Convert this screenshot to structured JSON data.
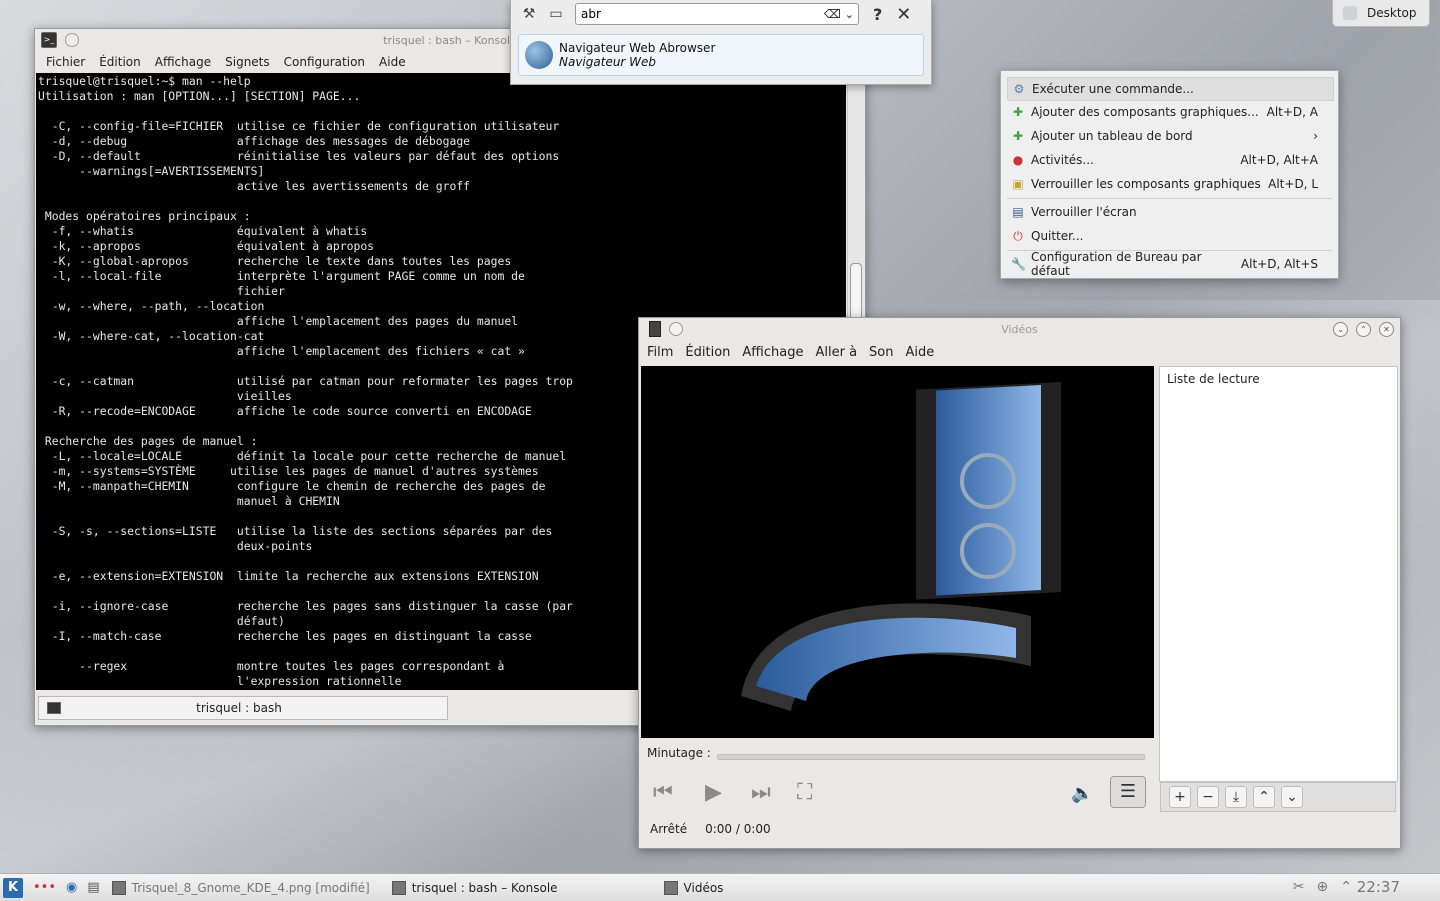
{
  "desktop": {
    "button_label": "Desktop"
  },
  "konsole": {
    "title": "trisquel : bash – Konsole",
    "menu": [
      "Fichier",
      "Édition",
      "Affichage",
      "Signets",
      "Configuration",
      "Aide"
    ],
    "tab_label": "trisquel : bash",
    "terminal_lines": [
      "trisquel@trisquel:~$ man --help",
      "Utilisation : man [OPTION...] [SECTION] PAGE...",
      "",
      "  -C, --config-file=FICHIER  utilise ce fichier de configuration utilisateur",
      "  -d, --debug                affichage des messages de débogage",
      "  -D, --default              réinitialise les valeurs par défaut des options",
      "      --warnings[=AVERTISSEMENTS]",
      "                             active les avertissements de groff",
      "",
      " Modes opératoires principaux :",
      "  -f, --whatis               équivalent à whatis",
      "  -k, --apropos              équivalent à apropos",
      "  -K, --global-apropos       recherche le texte dans toutes les pages",
      "  -l, --local-file           interprète l'argument PAGE comme un nom de",
      "                             fichier",
      "  -w, --where, --path, --location",
      "                             affiche l'emplacement des pages du manuel",
      "  -W, --where-cat, --location-cat",
      "                             affiche l'emplacement des fichiers « cat »",
      "",
      "  -c, --catman               utilisé par catman pour reformater les pages trop",
      "                             vieilles",
      "  -R, --recode=ENCODAGE      affiche le code source converti en ENCODAGE",
      "",
      " Recherche des pages de manuel :",
      "  -L, --locale=LOCALE        définit la locale pour cette recherche de manuel",
      "  -m, --systems=SYSTÈME     utilise les pages de manuel d'autres systèmes",
      "  -M, --manpath=CHEMIN       configure le chemin de recherche des pages de",
      "                             manuel à CHEMIN",
      "",
      "  -S, -s, --sections=LISTE   utilise la liste des sections séparées par des",
      "                             deux-points",
      "",
      "  -e, --extension=EXTENSION  limite la recherche aux extensions EXTENSION",
      "",
      "  -i, --ignore-case          recherche les pages sans distinguer la casse (par",
      "                             défaut)",
      "  -I, --match-case           recherche les pages en distinguant la casse",
      "",
      "      --regex                montre toutes les pages correspondant à",
      "                             l'expression rationnelle"
    ]
  },
  "krunner": {
    "query": "abr",
    "result_title": "Navigateur Web Abrowser",
    "result_subtitle": "Navigateur Web",
    "icons": [
      "settings-icon",
      "activity-icon",
      "help-icon",
      "close-icon"
    ]
  },
  "context_menu": {
    "items": [
      {
        "label": "Exécuter une commande...",
        "shortcut": "",
        "icon": "run-icon",
        "selected": true
      },
      {
        "label": "Ajouter des composants graphiques...",
        "shortcut": "Alt+D, A",
        "icon": "plus-icon"
      },
      {
        "label": "Ajouter un tableau de bord",
        "shortcut": "›",
        "icon": "plus-icon"
      },
      {
        "label": "Activités...",
        "shortcut": "Alt+D, Alt+A",
        "icon": "activities-icon"
      },
      {
        "label": "Verrouiller les composants graphiques",
        "shortcut": "Alt+D, L",
        "icon": "lock-icon"
      },
      {
        "label": "Verrouiller l'écran",
        "shortcut": "",
        "icon": "screen-lock-icon"
      },
      {
        "label": "Quitter...",
        "shortcut": "",
        "icon": "power-icon"
      },
      {
        "label": "Configuration de Bureau par défaut",
        "shortcut": "Alt+D, Alt+S",
        "icon": "wrench-icon"
      }
    ]
  },
  "videos": {
    "title": "Vidéos",
    "menu": [
      "Film",
      "Édition",
      "Affichage",
      "Aller à",
      "Son",
      "Aide"
    ],
    "playlist_header": "Liste de lecture",
    "minutage_label": "Minutage :",
    "status": "Arrêté",
    "time": "0:00 / 0:00"
  },
  "taskbar": {
    "tasks": [
      "Trisquel_8_Gnome_KDE_4.png [modifié]",
      "trisquel : bash – Konsole",
      "Vidéos"
    ],
    "clock": "22:37"
  },
  "colors": {
    "accent": "#2b6bb0",
    "terminal_bg": "#000000",
    "terminal_fg": "#e8e8e8"
  }
}
